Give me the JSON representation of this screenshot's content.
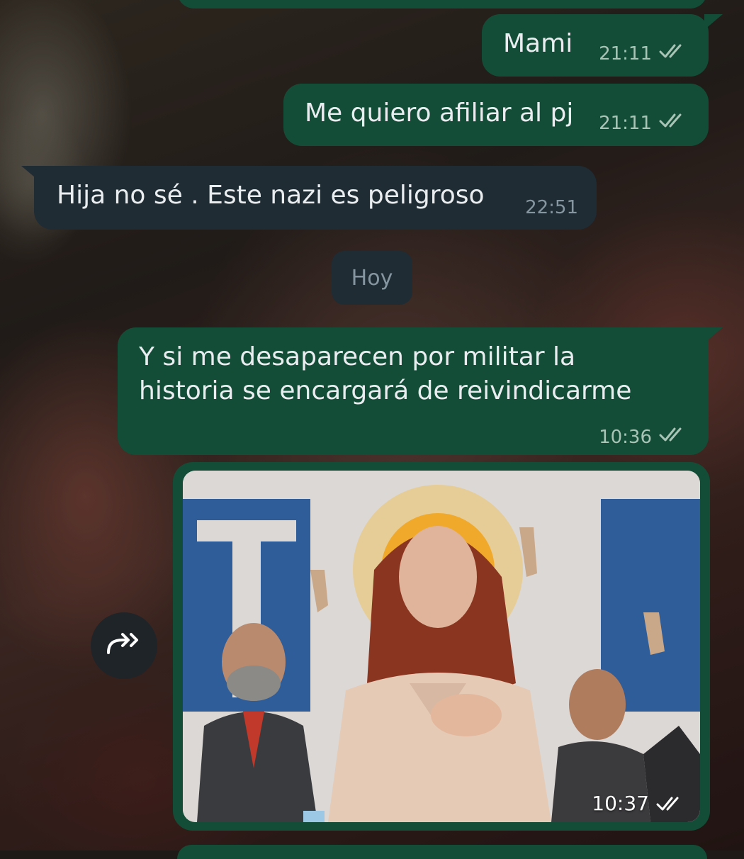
{
  "messages": [
    {
      "text": "Mami",
      "time": "21:11",
      "dir": "out"
    },
    {
      "text": "Me quiero afiliar al pj",
      "time": "21:11",
      "dir": "out"
    },
    {
      "text": "Hija no sé . Este nazi es peligroso",
      "time": "22:51",
      "dir": "in"
    },
    {
      "text": "Y si me desaparecen por militar la\nhistoria se encargará de reivindicarme",
      "time": "10:36",
      "dir": "out"
    },
    {
      "text": "",
      "time": "10:37",
      "dir": "out",
      "type": "image"
    }
  ],
  "date_separator": "Hoy",
  "icons": {
    "read_receipt": "double-check-icon",
    "forward": "forward-icon"
  },
  "colors": {
    "outgoing_bubble": "#144d37",
    "incoming_bubble": "#1f2c34",
    "text": "#e9edef",
    "meta_out": "#a8c4b7",
    "meta_in": "#8696a0"
  }
}
